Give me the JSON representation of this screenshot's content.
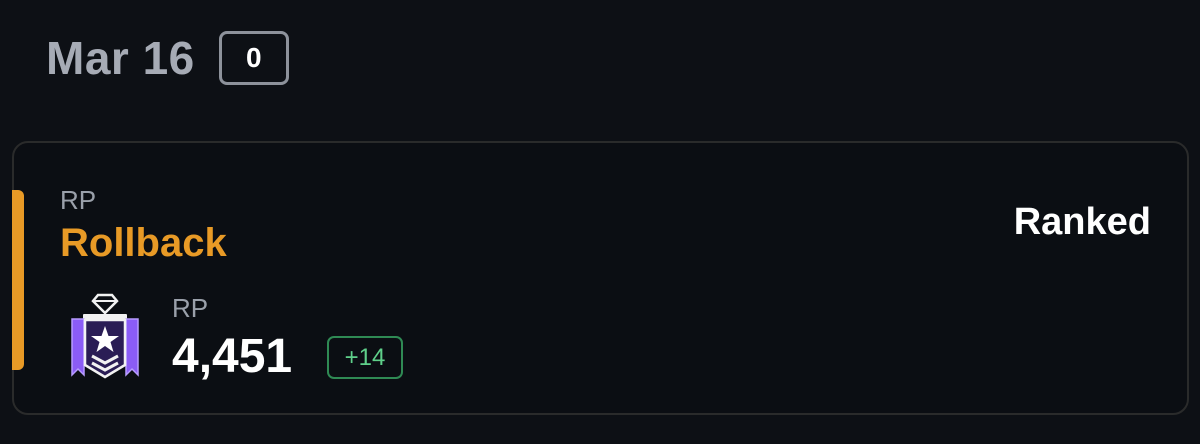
{
  "header": {
    "date": "Mar 16",
    "count": "0"
  },
  "match": {
    "caption": "RP",
    "outcome": "Rollback",
    "mode": "Ranked",
    "rank": {
      "icon": "rank-emblem-icon",
      "rp_caption": "RP",
      "rp_value": "4,451",
      "rp_delta": "+14"
    }
  },
  "colors": {
    "background": "#0d1015",
    "accent": "#e89a26",
    "positive": "#5fd08a",
    "rank_emblem": "#8b5cf6"
  }
}
